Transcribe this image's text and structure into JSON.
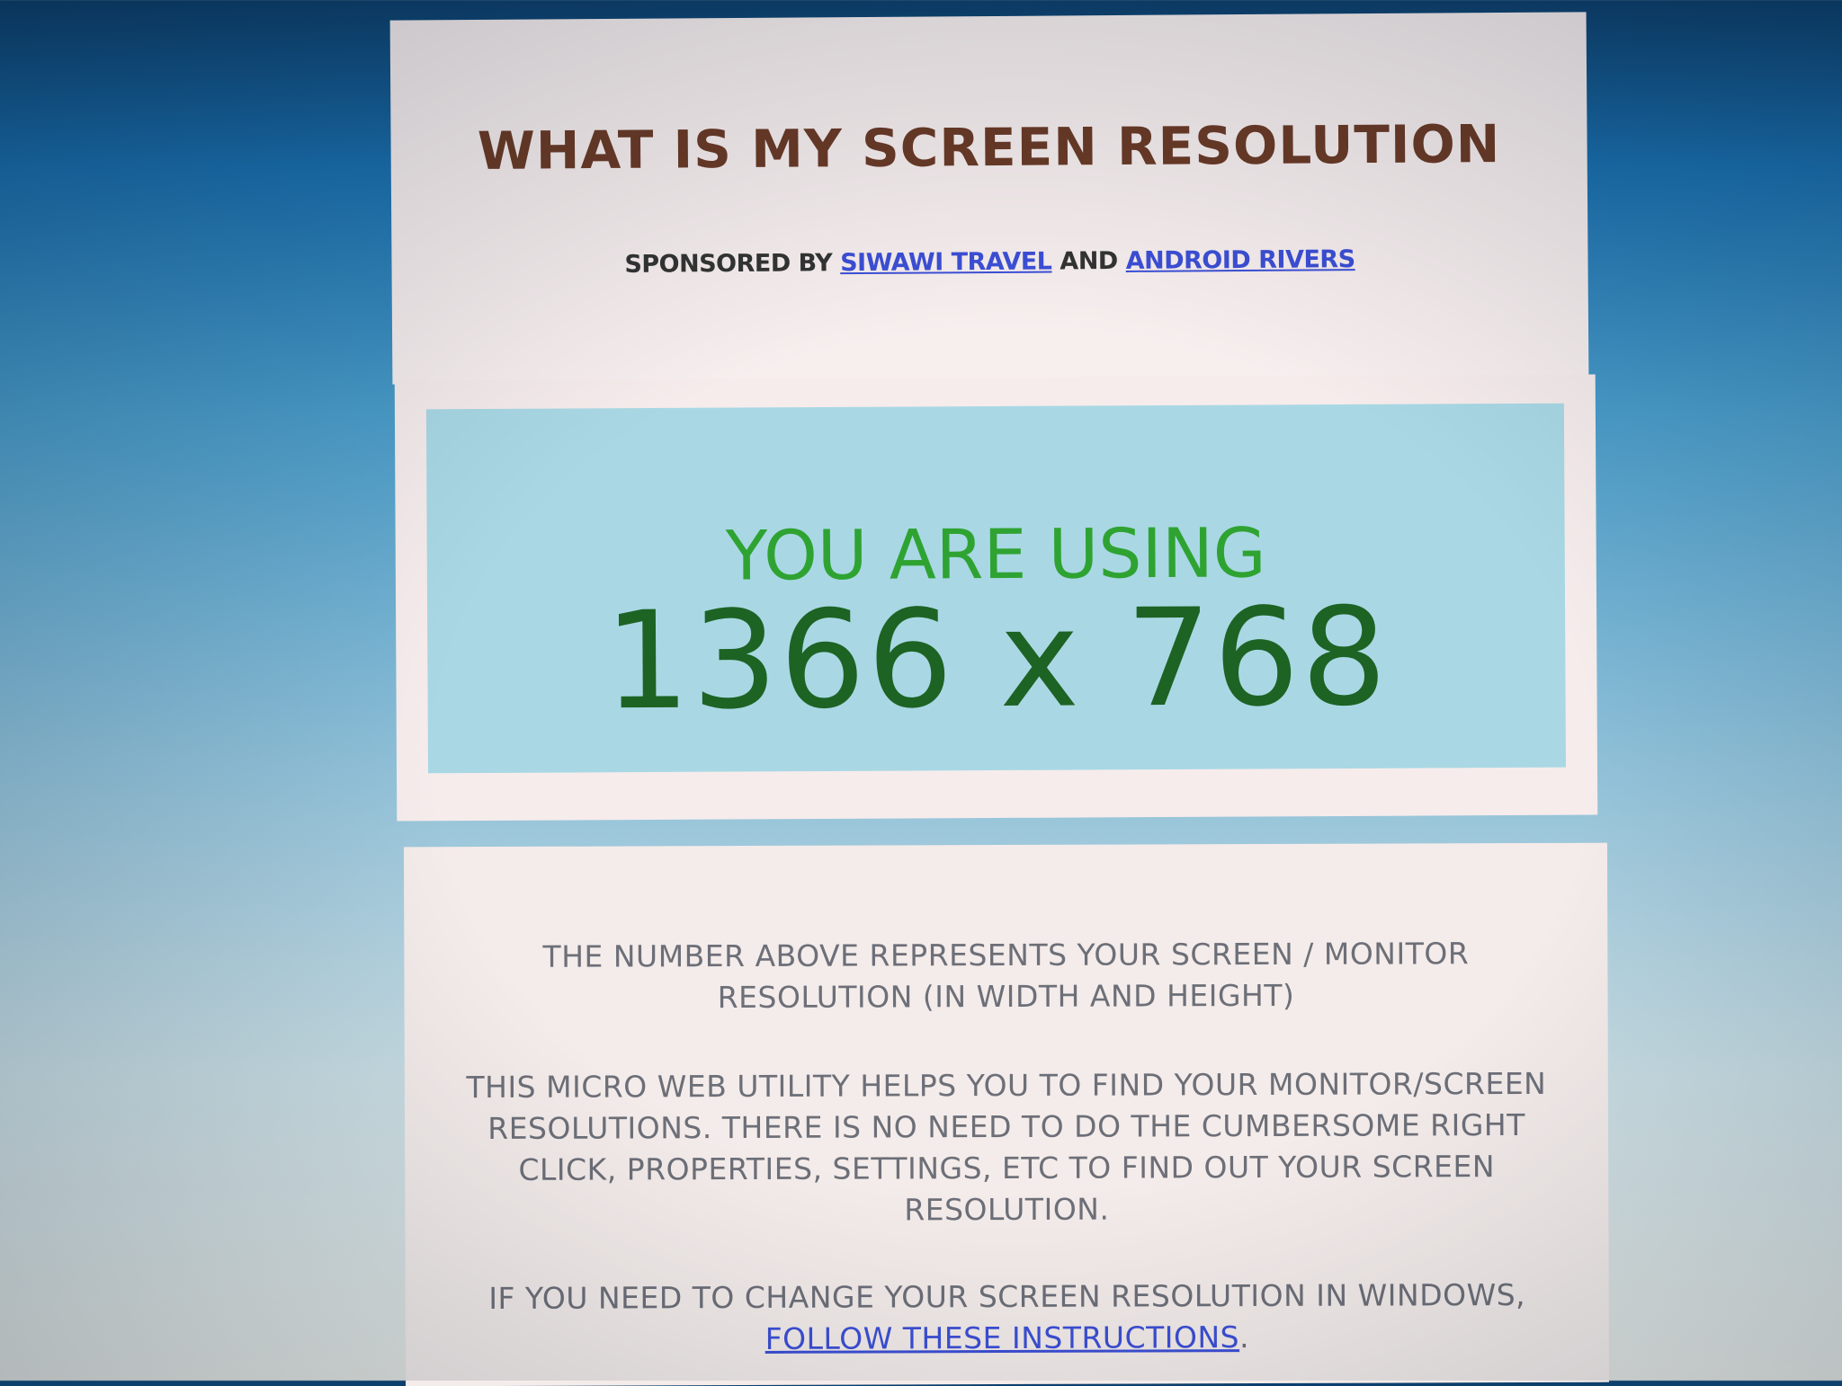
{
  "header": {
    "title": "WHAT IS MY SCREEN RESOLUTION",
    "sponsor_prefix": "SPONSORED BY",
    "sponsor_link_1": "SIWAWI TRAVEL",
    "sponsor_and": "AND",
    "sponsor_link_2": "ANDROID RIVERS"
  },
  "result": {
    "label": "YOU ARE USING",
    "value": "1366 x 768"
  },
  "info": {
    "paragraph_1": "THE NUMBER ABOVE REPRESENTS YOUR SCREEN / MONITOR RESOLUTION (IN WIDTH AND HEIGHT)",
    "paragraph_2": "THIS MICRO WEB UTILITY HELPS YOU TO FIND YOUR MONITOR/SCREEN RESOLUTIONS. THERE IS NO NEED TO DO THE CUMBERSOME RIGHT CLICK, PROPERTIES, SETTINGS, ETC TO FIND OUT YOUR SCREEN RESOLUTION.",
    "paragraph_3_prefix": "IF YOU NEED TO CHANGE YOUR SCREEN RESOLUTION IN WINDOWS,",
    "paragraph_3_link": "FOLLOW THESE INSTRUCTIONS",
    "paragraph_3_suffix": "."
  },
  "colors": {
    "title": "#6b3a26",
    "link": "#3c4fd6",
    "using_label": "#2fa332",
    "resolution_value": "#1d6324",
    "result_box": "#a9d8e4",
    "body_text": "#6d6f78"
  }
}
